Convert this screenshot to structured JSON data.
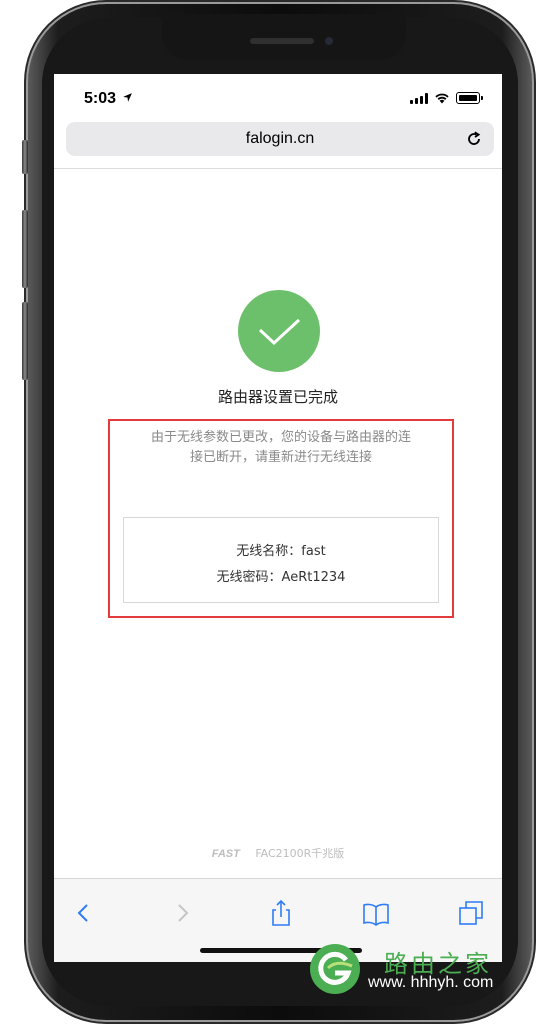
{
  "status_bar": {
    "time": "5:03",
    "location_icon": "location-arrow-icon",
    "signal_icon": "cellular-signal-icon",
    "wifi_icon": "wifi-icon",
    "battery_icon": "battery-icon"
  },
  "browser": {
    "url": "falogin.cn",
    "reload_icon": "reload-icon"
  },
  "content": {
    "success_icon": "checkmark-icon",
    "title": "路由器设置已完成",
    "message_line1": "由于无线参数已更改，您的设备与路由器的连",
    "message_line2": "接已断开，请重新进行无线连接",
    "wifi_name_label": "无线名称：fast",
    "wifi_password_label": "无线密码：AeRt1234"
  },
  "footer": {
    "brand": "FAST",
    "model": "FAC2100R千兆版"
  },
  "toolbar": {
    "back_icon": "chevron-left-icon",
    "forward_icon": "chevron-right-icon",
    "share_icon": "share-icon",
    "bookmarks_icon": "book-icon",
    "tabs_icon": "tabs-icon"
  },
  "watermark": {
    "title": "路由之家",
    "url": "www. hhhyh. com"
  },
  "colors": {
    "success_green": "#6cc06b",
    "highlight_red": "#e23b3b",
    "ios_blue": "#2f7cf6",
    "watermark_green": "#4cae52"
  }
}
